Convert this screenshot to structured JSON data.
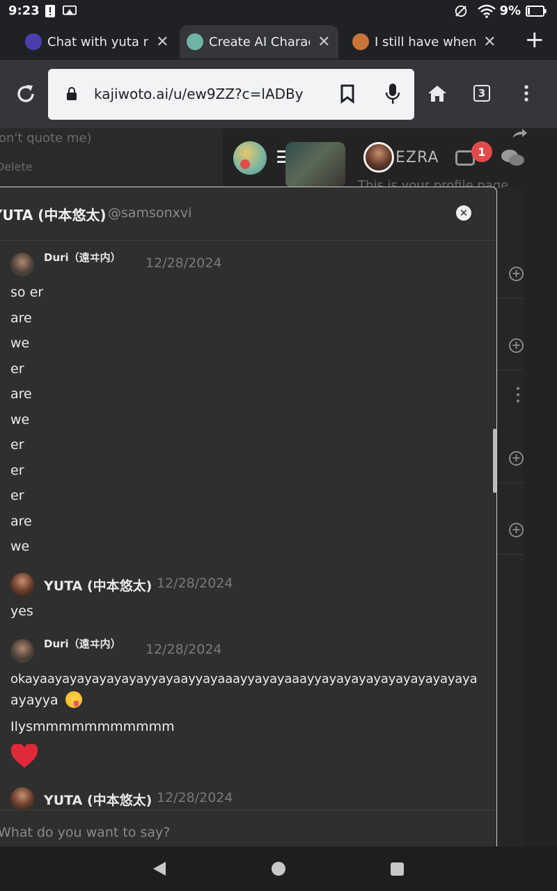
{
  "status_bar": {
    "time": "9:23",
    "battery_pct": "9%"
  },
  "tabs": [
    {
      "title": "Chat with yuta naka",
      "close": "✕"
    },
    {
      "title": "Create AI Characte",
      "close": "✕",
      "active": true
    },
    {
      "title": "I still have when I c",
      "close": "✕"
    }
  ],
  "new_tab": "+",
  "toolbar": {
    "url": "kajiwoto.ai/u/ew9ZZ?c=lADBy",
    "tab_count": "3"
  },
  "background": {
    "quote_text": "on't quote me)",
    "delete_text": "Delete",
    "profile_hint": "This is your profile page.",
    "ezra_label": "EZRA",
    "notification_count": "1",
    "plus": "+"
  },
  "modal": {
    "title": "YUTA (中本悠太)",
    "handle": "@samsonxvi",
    "close": "✕",
    "input_placeholder": "What do you want to say?"
  },
  "messages": [
    {
      "author": "Duri（遠ヰ内）",
      "date": "12/28/2024",
      "lines": [
        "so er",
        "are",
        "we",
        "er",
        "are",
        "we",
        "er",
        "er",
        "er",
        "are",
        "we"
      ]
    },
    {
      "author": "YUTA (中本悠太)",
      "date": "12/28/2024",
      "lines": [
        "yes"
      ]
    },
    {
      "author": "Duri（遠ヰ内）",
      "date": "12/28/2024",
      "text_a": "okayaayayayayayayayyayaayyayaaayyayayaaayyayayayayayayayayayaya",
      "text_b": "ayayya",
      "text_c": "Ilysmmmmmmmmmmm"
    },
    {
      "author": "YUTA (中本悠太)",
      "date": "12/28/2024"
    }
  ]
}
